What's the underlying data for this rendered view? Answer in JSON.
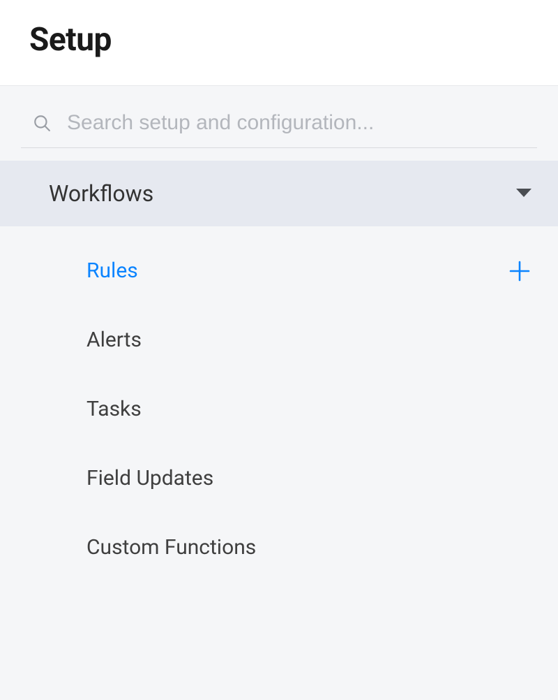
{
  "header": {
    "title": "Setup"
  },
  "search": {
    "placeholder": "Search setup and configuration...",
    "value": ""
  },
  "section": {
    "label": "Workflows",
    "expanded": true
  },
  "items": [
    {
      "label": "Rules",
      "active": true,
      "has_add": true
    },
    {
      "label": "Alerts",
      "active": false,
      "has_add": false
    },
    {
      "label": "Tasks",
      "active": false,
      "has_add": false
    },
    {
      "label": "Field Updates",
      "active": false,
      "has_add": false
    },
    {
      "label": "Custom Functions",
      "active": false,
      "has_add": false
    }
  ],
  "colors": {
    "accent": "#0b84ff",
    "section_bg": "#e6e9f0",
    "body_bg": "#f5f6f8"
  }
}
